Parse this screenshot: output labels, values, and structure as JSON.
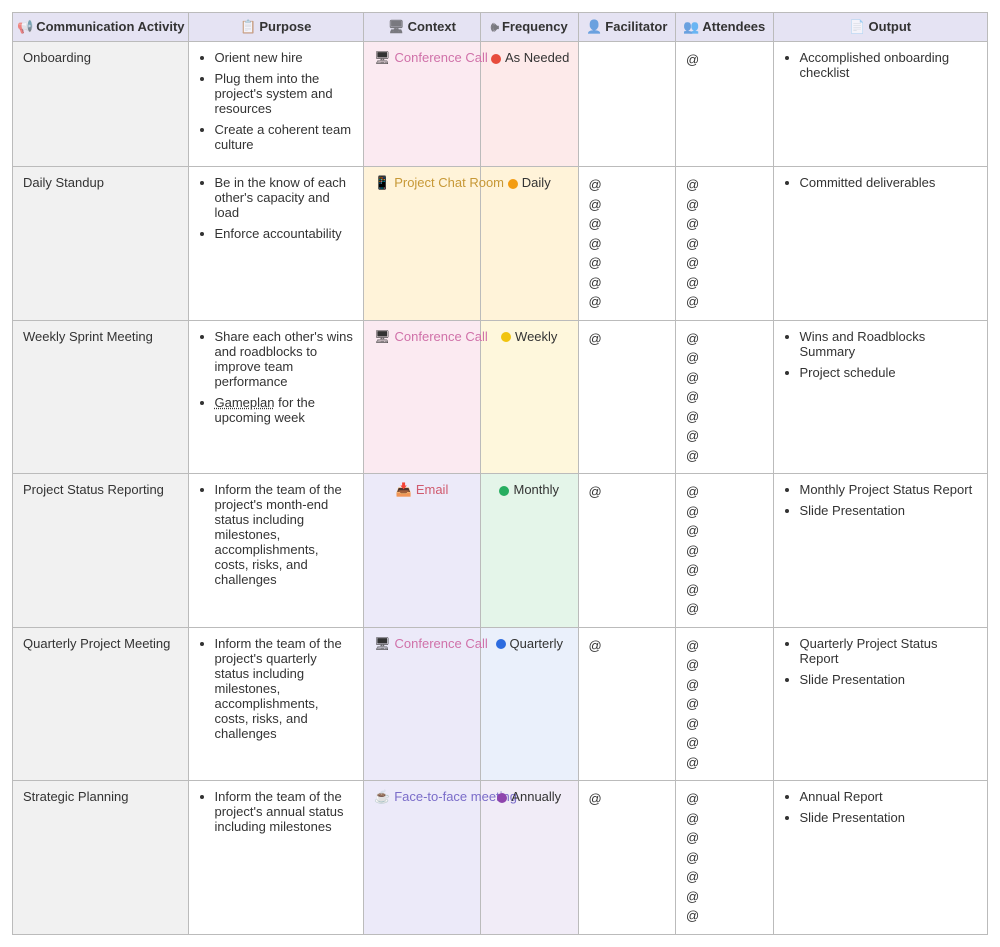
{
  "headers": {
    "activity": "Communication Activity",
    "purpose": "Purpose",
    "context": "Context",
    "frequency": "Frequency",
    "facilitator": "Facilitator",
    "attendees": "Attendees",
    "output": "Output"
  },
  "header_icons": {
    "activity": "📢",
    "purpose": "📋",
    "context": "🖥",
    "frequency": "🕪",
    "facilitator": "👤",
    "attendees": "👥",
    "output": "📄"
  },
  "context_labels": {
    "conference": "Conference Call",
    "chat": "Project Chat Room",
    "email": "Email",
    "f2f": "Face-to-face meeting"
  },
  "context_icons": {
    "conference": "🖥",
    "chat": "📱",
    "email": "📥",
    "f2f": "☕"
  },
  "frequency_labels": {
    "asneeded": "As Needed",
    "daily": "Daily",
    "weekly": "Weekly",
    "monthly": "Monthly",
    "quarterly": "Quarterly",
    "annually": "Annually"
  },
  "at_symbol": "@",
  "rows": [
    {
      "activity": "Onboarding",
      "purpose": [
        "Orient new hire",
        "Plug them into the project's system and resources",
        "Create a coherent team culture"
      ],
      "context": "conference",
      "context_bg": "pink",
      "frequency": "asneeded",
      "freq_bg": "red",
      "freq_dot": "red",
      "facilitator_count": 0,
      "attendee_count": 1,
      "output": [
        "Accomplished onboarding checklist"
      ]
    },
    {
      "activity": "Daily Standup",
      "purpose": [
        "Be in the know of each other's capacity and load",
        "Enforce accountability"
      ],
      "context": "chat",
      "context_bg": "orange",
      "frequency": "daily",
      "freq_bg": "orange",
      "freq_dot": "orange",
      "facilitator_count": 7,
      "attendee_count": 7,
      "output": [
        "Committed deliverables"
      ]
    },
    {
      "activity": "Weekly Sprint Meeting",
      "purpose": [
        "Share each other's wins and roadblocks to improve team performance",
        "<u>Gameplan</u> for the upcoming week"
      ],
      "context": "conference",
      "context_bg": "pink",
      "frequency": "weekly",
      "freq_bg": "yellow",
      "freq_dot": "yellow",
      "facilitator_count": 1,
      "attendee_count": 7,
      "output": [
        "Wins and Roadblocks Summary",
        "Project schedule"
      ]
    },
    {
      "activity": "Project Status Reporting",
      "purpose": [
        "Inform the team of the project's month-end status including milestones, accomplishments, costs, risks, and challenges"
      ],
      "context": "email",
      "context_bg": "blue",
      "frequency": "monthly",
      "freq_bg": "green",
      "freq_dot": "green",
      "facilitator_count": 1,
      "attendee_count": 7,
      "output": [
        "Monthly Project Status Report",
        "Slide Presentation"
      ]
    },
    {
      "activity": "Quarterly Project Meeting",
      "purpose": [
        "Inform the team of the project's quarterly status including milestones, accomplishments, costs, risks, and challenges"
      ],
      "context": "conference",
      "context_bg": "blue",
      "frequency": "quarterly",
      "freq_bg": "blue",
      "freq_dot": "blue",
      "facilitator_count": 1,
      "attendee_count": 7,
      "output": [
        "Quarterly Project Status Report",
        "Slide Presentation"
      ]
    },
    {
      "activity": "Strategic Planning",
      "purpose": [
        "Inform the team of the project's annual status including milestones"
      ],
      "context": "f2f",
      "context_bg": "blue",
      "frequency": "annually",
      "freq_bg": "purple",
      "freq_dot": "purple",
      "facilitator_count": 1,
      "attendee_count": 7,
      "output": [
        "Annual Report",
        "Slide Presentation"
      ]
    }
  ]
}
